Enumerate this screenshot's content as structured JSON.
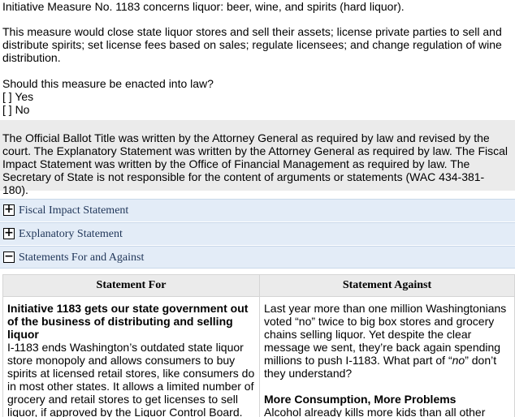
{
  "summary": {
    "caption": "Initiative Measure No. 1183 concerns liquor:  beer, wine, and spirits (hard liquor).",
    "description": "This measure would close state liquor stores and sell their assets; license private parties to sell and distribute spirits; set license fees based on sales; regulate licensees; and change regulation of wine distribution.",
    "question": "Should this measure be enacted into law?",
    "options": [
      {
        "box": "[ ]",
        "label": "Yes"
      },
      {
        "box": "[ ]",
        "label": "No"
      }
    ]
  },
  "official_note": "The Official Ballot Title was written by the Attorney General as required by law and revised by the court. The Explanatory Statement was written by the Attorney General as required by law. The Fiscal Impact Statement was written by the Office of Financial Management as required by law. The Secretary of State is not responsible for the content of arguments or statements (WAC 434-381-180).",
  "sections": [
    {
      "icon": "+",
      "label": "Fiscal Impact Statement"
    },
    {
      "icon": "+",
      "label": "Explanatory Statement"
    },
    {
      "icon": "−",
      "label": "Statements For and Against"
    }
  ],
  "statements": {
    "for_header": "Statement For",
    "against_header": "Statement Against",
    "for": {
      "heading": "Initiative 1183 gets our state government out of the business of distributing and selling liquor",
      "body": "I-1183 ends Washington’s outdated state liquor store monopoly and allows consumers to buy spirits at licensed retail stores, like consumers do in most other states. It allows a limited number of grocery and retail stores to get licenses to sell liquor, if approved by the Liquor Control Board."
    },
    "against": {
      "body_before": "Last year more than one million Washingtonians voted “no” twice to big box stores and grocery chains selling liquor. Yet despite the clear message we sent, they’re back again spending millions to push I-1183. What part of “",
      "body_italic": "no",
      "body_after": "” don’t they understand?",
      "heading": "More Consumption, More Problems",
      "body2": "Alcohol already kills more kids than all other"
    }
  }
}
